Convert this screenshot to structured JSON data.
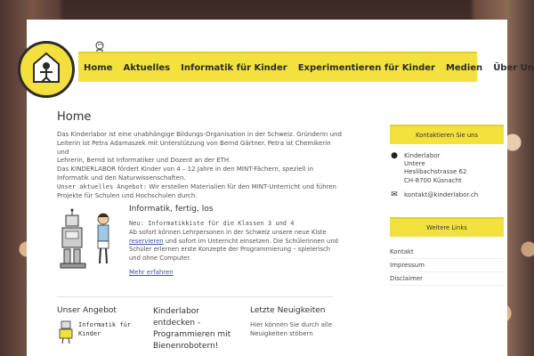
{
  "nav": {
    "items": [
      "Home",
      "Aktuelles",
      "Informatik für Kinder",
      "Experimentieren für Kinder",
      "Medien",
      "Über Uns"
    ]
  },
  "logo": {
    "alt_text": "www.kinderlabor.ch"
  },
  "main": {
    "title": "Home",
    "intro": [
      "Das Kinderlabor ist eine unabhängige Bildungs-Organisation in der Schweiz. Gründerin und",
      "Leiterin ist Petra Adamaszek mit Unterstützung von Bernd Gärtner. Petra ist Chemikerin und",
      "Lehrerin, Bernd ist Informatiker und Dozent an der ETH.",
      "Das KINDERLABOR fördert Kinder von 4 – 12 Jahre in den MINT-Fächern, speziell in",
      "Informatik und den Naturwissenschaften."
    ],
    "intro_mono": "Unser aktuelles Angebot:",
    "intro_last": " Wir erstellen Materialien für den MINT-Unterricht und führen",
    "intro_last2": "Projekte für Schulen und Hochschulen durch.",
    "feature": {
      "title": "Informatik, fertig, los",
      "subtitle": "Neu: Informatikkiste für die Klassen 3 und 4",
      "desc_1": "Ab sofort können Lehrpersonen in der Schweiz unsere neue Kiste",
      "desc_link": "reservieren",
      "desc_2": " und sofort im Unterricht einsetzen. Die Schülerinnen und",
      "desc_3": "Schüler erlernen erste Konzepte der Programmierung – spielerisch",
      "desc_4": "und ohne Computer.",
      "more_link": "Mehr erfahren"
    }
  },
  "bottom": {
    "angebot": {
      "title": "Unser Angebot",
      "line1": "Informatik für",
      "line2": "Kinder"
    },
    "entdecken": {
      "title_1": "Kinderlabor",
      "title_2": "entdecken -",
      "title_3": "Programmieren mit",
      "title_4": "Bienenrobotern!"
    },
    "news": {
      "title": "Letzte Neuigkeiten",
      "line1": "Hier können Sie durch alle",
      "line2": "Neuigkeiten stöbern"
    }
  },
  "sidebar": {
    "contact_title": "Kontaktieren Sie uns",
    "address": [
      "Kinderlabor",
      "Untere",
      "Heslibachstrasse 62",
      "CH-8700 Küsnacht"
    ],
    "email": "kontakt@kinderlabor.ch",
    "links_title": "Weitere Links",
    "links": [
      "Kontakt",
      "Impressum",
      "Disclaimer"
    ]
  },
  "colors": {
    "accent": "#f3e23c",
    "link": "#3a53a4"
  }
}
